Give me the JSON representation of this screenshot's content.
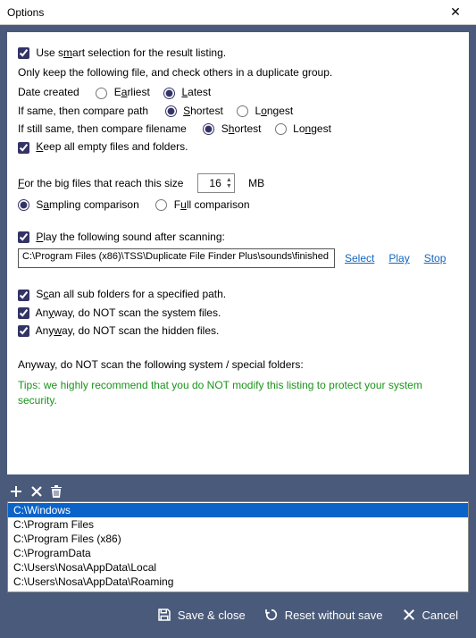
{
  "window": {
    "title": "Options"
  },
  "smart": {
    "use_label_pre": "Use s",
    "use_label_u": "m",
    "use_label_post": "art selection for the result listing.",
    "keep_desc": "Only keep the following file, and check others in a duplicate group.",
    "date_label": "Date created",
    "date_earliest_pre": "E",
    "date_earliest_u": "a",
    "date_earliest_post": "rliest",
    "date_latest_pre": "",
    "date_latest_u": "L",
    "date_latest_post": "atest",
    "path_label": "If same, then compare path",
    "path_shortest_pre": "",
    "path_shortest_u": "S",
    "path_shortest_post": "hortest",
    "path_longest_pre": "L",
    "path_longest_u": "o",
    "path_longest_post": "ngest",
    "fname_label": "If still same, then compare filename",
    "fname_shortest_pre": "S",
    "fname_shortest_u": "h",
    "fname_shortest_post": "ortest",
    "fname_longest_pre": "Lo",
    "fname_longest_u": "n",
    "fname_longest_post": "gest",
    "keep_empty_pre": "",
    "keep_empty_u": "K",
    "keep_empty_post": "eep all empty files and folders."
  },
  "big": {
    "label_pre": "",
    "label_u": "F",
    "label_post": "or the big files that reach this size",
    "value": "16",
    "unit": "MB",
    "sampling_pre": "S",
    "sampling_u": "a",
    "sampling_post": "mpling comparison",
    "full_pre": "F",
    "full_u": "u",
    "full_post": "ll comparison"
  },
  "sound": {
    "play_pre": "",
    "play_u": "P",
    "play_post": "lay the following sound after scanning:",
    "path": "C:\\Program Files (x86)\\TSS\\Duplicate File Finder Plus\\sounds\\finished",
    "select": "Select",
    "play_link": "Play",
    "stop": "Stop"
  },
  "scan": {
    "sub_pre": "S",
    "sub_u": "c",
    "sub_post": "an all sub folders for a specified path.",
    "sys_pre": "An",
    "sys_u": "y",
    "sys_post": "way, do NOT scan the system files.",
    "hid_pre": "Any",
    "hid_u": "w",
    "hid_post": "ay, do NOT scan the hidden files."
  },
  "exclude": {
    "heading": "Anyway, do NOT scan the following system / special folders:",
    "tip": "Tips: we highly recommend that you do NOT modify this listing to protect your system security.",
    "items": [
      "C:\\Windows",
      "C:\\Program Files",
      "C:\\Program Files (x86)",
      "C:\\ProgramData",
      "C:\\Users\\Nosa\\AppData\\Local",
      "C:\\Users\\Nosa\\AppData\\Roaming"
    ],
    "selected_index": 0
  },
  "footer": {
    "save": "Save & close",
    "reset": "Reset without save",
    "cancel": "Cancel"
  }
}
